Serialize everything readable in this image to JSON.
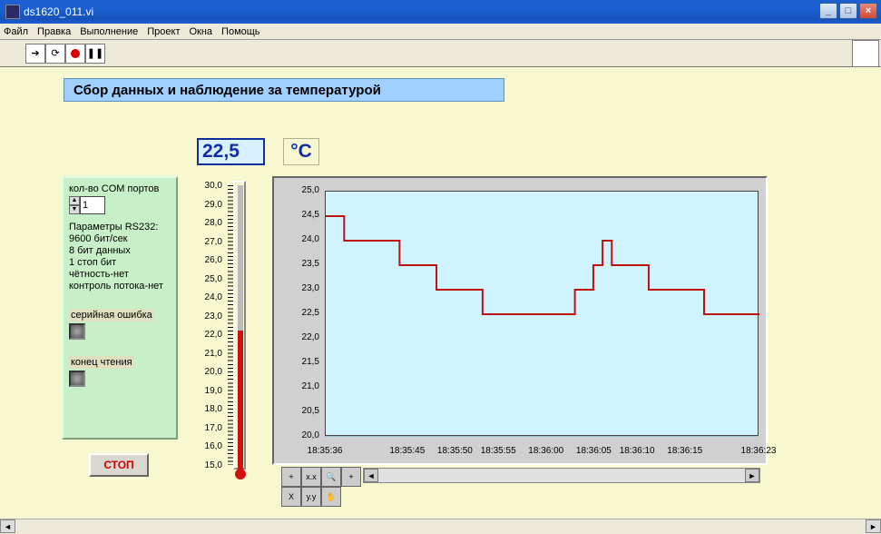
{
  "window": {
    "title": "ds1620_011.vi"
  },
  "menu": [
    "Файл",
    "Правка",
    "Выполнение",
    "Проект",
    "Окна",
    "Помощь"
  ],
  "header": {
    "title": "Сбор данных и наблюдение за температурой"
  },
  "readout": {
    "value": "22,5",
    "unit": "°C"
  },
  "panel": {
    "com_label": "кол-во COM портов",
    "com_value": "1",
    "params": [
      "Параметры RS232:",
      "9600 бит/сек",
      "8 бит данных",
      "1 стоп бит",
      "чётность-нет",
      "контроль потока-нет"
    ],
    "serial_error": "серийная ошибка",
    "end_read": "конец чтения"
  },
  "stop": "СТОП",
  "thermo_ticks": [
    "30,0",
    "29,0",
    "28,0",
    "27,0",
    "26,0",
    "25,0",
    "24,0",
    "23,0",
    "22,0",
    "21,0",
    "20,0",
    "19,0",
    "18,0",
    "17,0",
    "16,0",
    "15,0"
  ],
  "chart_data": {
    "type": "line",
    "ymin": 20.0,
    "ymax": 25.0,
    "yticks": [
      "25,0",
      "24,5",
      "24,0",
      "23,5",
      "23,0",
      "22,5",
      "22,0",
      "21,5",
      "21,0",
      "20,5",
      "20,0"
    ],
    "xticks": [
      "18:35:36",
      "18:35:45",
      "18:35:50",
      "18:35:55",
      "18:36:00",
      "18:36:05",
      "18:36:10",
      "18:36:15",
      "18:36:23"
    ],
    "xtick_pos": [
      0,
      0.19,
      0.3,
      0.4,
      0.51,
      0.62,
      0.72,
      0.83,
      1.0
    ],
    "values": [
      24.5,
      24.5,
      24.0,
      24.0,
      24.0,
      24.0,
      24.0,
      24.0,
      23.5,
      23.5,
      23.5,
      23.5,
      23.0,
      23.0,
      23.0,
      23.0,
      23.0,
      22.5,
      22.5,
      22.5,
      22.5,
      22.5,
      22.5,
      22.5,
      22.5,
      22.5,
      22.5,
      23.0,
      23.0,
      23.5,
      24.0,
      23.5,
      23.5,
      23.5,
      23.5,
      23.0,
      23.0,
      23.0,
      23.0,
      23.0,
      23.0,
      22.5,
      22.5,
      22.5,
      22.5,
      22.5,
      22.5,
      22.5
    ],
    "line_color": "#c01010"
  }
}
